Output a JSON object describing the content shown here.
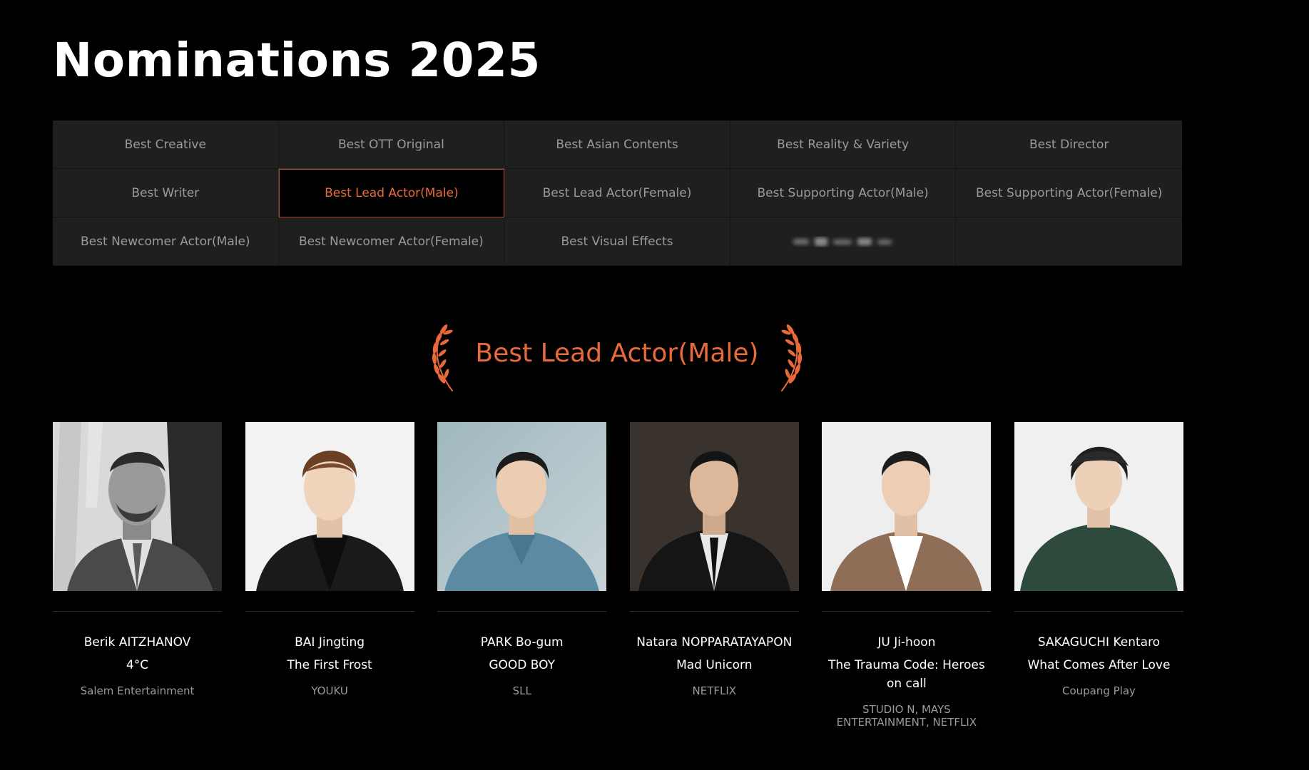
{
  "page": {
    "title": "Nominations 2025"
  },
  "categories": [
    {
      "label": "Best Creative",
      "active": false
    },
    {
      "label": "Best OTT Original",
      "active": false
    },
    {
      "label": "Best Asian Contents",
      "active": false
    },
    {
      "label": "Best Reality & Variety",
      "active": false
    },
    {
      "label": "Best Director",
      "active": false
    },
    {
      "label": "Best Writer",
      "active": false
    },
    {
      "label": "Best Lead Actor(Male)",
      "active": true
    },
    {
      "label": "Best Lead Actor(Female)",
      "active": false
    },
    {
      "label": "Best Supporting Actor(Male)",
      "active": false
    },
    {
      "label": "Best Supporting Actor(Female)",
      "active": false
    },
    {
      "label": "Best Newcomer Actor(Male)",
      "active": false
    },
    {
      "label": "Best Newcomer Actor(Female)",
      "active": false
    },
    {
      "label": "Best Visual Effects",
      "active": false
    },
    {
      "label": "",
      "active": false,
      "blurred": true
    },
    {
      "label": "",
      "active": false
    }
  ],
  "award": {
    "title": "Best Lead Actor(Male)"
  },
  "nominees": [
    {
      "name": "Berik AITZHANOV",
      "work": "4°C",
      "company": "Salem Entertainment"
    },
    {
      "name": "BAI Jingting",
      "work": "The First Frost",
      "company": "YOUKU"
    },
    {
      "name": "PARK Bo-gum",
      "work": "GOOD BOY",
      "company": "SLL"
    },
    {
      "name": "Natara NOPPARATAYAPON",
      "work": "Mad Unicorn",
      "company": "NETFLIX"
    },
    {
      "name": "JU Ji-hoon",
      "work": "The Trauma Code: Heroes on call",
      "company": "STUDIO N, MAYS ENTERTAINMENT, NETFLIX"
    },
    {
      "name": "SAKAGUCHI Kentaro",
      "work": "What Comes After Love",
      "company": "Coupang Play"
    }
  ],
  "colors": {
    "background": "#000000",
    "accent": "#e8693a",
    "cell_bg": "#1f1f1f",
    "muted_text": "#9a9a9a"
  },
  "icons": {
    "laurel_left": "laurel-branch-left-icon",
    "laurel_right": "laurel-branch-right-icon"
  }
}
